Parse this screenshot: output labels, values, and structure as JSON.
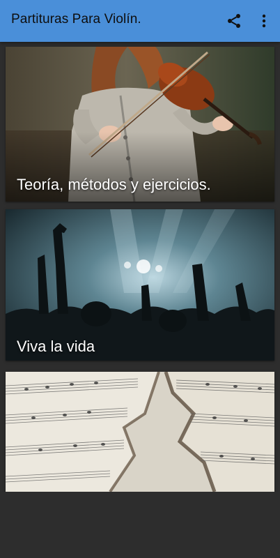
{
  "app": {
    "title": "Partituras Para Violín.",
    "accent_color": "#4a8fd9",
    "background_color": "#2d2d2d"
  },
  "actions": {
    "share_icon": "share-icon",
    "more_icon": "more-vert-icon"
  },
  "cards": [
    {
      "label": "Teoría, métodos y ejercicios.",
      "image": "violinist-photo"
    },
    {
      "label": "Viva la vida",
      "image": "concert-crowd-photo"
    },
    {
      "label": "",
      "image": "sheet-music-photo"
    }
  ]
}
